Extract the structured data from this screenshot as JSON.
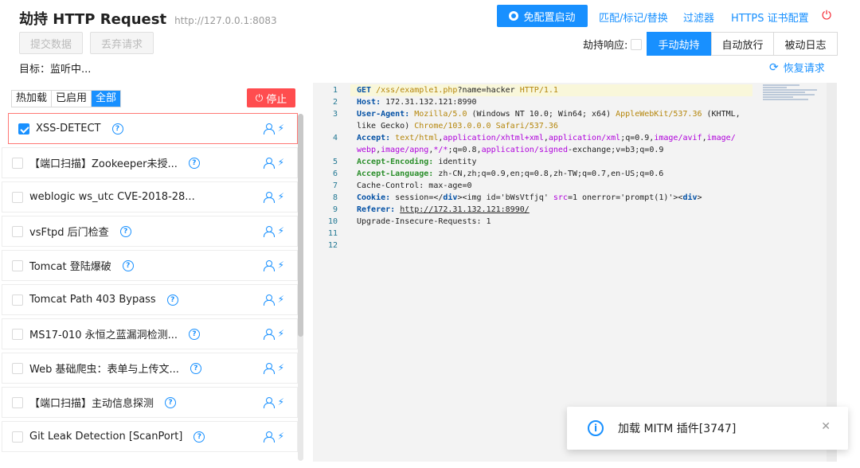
{
  "app": {
    "title": "劫持 HTTP Request",
    "url": "http://127.0.0.1:8083",
    "submit_label": "提交数据",
    "discard_label": "丢弃请求",
    "target_label": "目标：监听中..."
  },
  "toolbar": {
    "launch_label": "免配置启动",
    "match_label": "匹配/标记/替换",
    "filter_label": "过滤器",
    "https_label": "HTTPS 证书配置",
    "hijack_response_label": "劫持响应:",
    "modes": [
      "手动劫持",
      "自动放行",
      "被动日志"
    ],
    "active_mode": "手动劫持",
    "restore_label": "恢复请求"
  },
  "plugins": {
    "tabs": [
      "热加载",
      "已启用",
      "全部"
    ],
    "active_tab": "全部",
    "stop_label": "停止",
    "items": [
      {
        "name": "XSS-DETECT",
        "checked": true
      },
      {
        "name": "【端口扫描】Zookeeper未授...",
        "checked": false
      },
      {
        "name": "weblogic ws_utc CVE-2018-28...",
        "checked": false
      },
      {
        "name": "vsFtpd 后门检查",
        "checked": false
      },
      {
        "name": "Tomcat 登陆爆破",
        "checked": false
      },
      {
        "name": "Tomcat Path 403 Bypass",
        "checked": false
      },
      {
        "name": "MS17-010 永恒之蓝漏洞检测...",
        "checked": false
      },
      {
        "name": "Web 基础爬虫：表单与上传文...",
        "checked": false
      },
      {
        "name": "【端口扫描】主动信息探测",
        "checked": false
      },
      {
        "name": "Git Leak Detection [ScanPort]",
        "checked": false
      }
    ]
  },
  "editor": {
    "line_numbers": [
      "1",
      "2",
      "3",
      "",
      "4",
      "",
      "5",
      "6",
      "7",
      "8",
      "9",
      "10",
      "11",
      "12"
    ],
    "l1": {
      "method": "GET",
      "path": "/xss/example1.php",
      "query": "?name=hacker",
      "proto": "HTTP/1.1"
    },
    "l2": {
      "key": "Host:",
      "val": " 172.31.132.121:8990"
    },
    "l3": {
      "key": "User-Agent:",
      "a": " Mozilla/5.0",
      "b": " (Windows NT 10.0; Win64; x64) ",
      "c": "AppleWebKit/537.36",
      "d": " (KHTML,"
    },
    "l3b": {
      "a": "like Gecko) ",
      "b": "Chrome/103.0.0.0",
      "c": " ",
      "d": "Safari/537.36"
    },
    "l4": {
      "key": "Accept:",
      "a": " text/html",
      "b": ",",
      "c": "application/xhtml+xml",
      "d": ",",
      "e": "application/xml",
      "f": ";q=0.9,",
      "g": "image/avif",
      "h": ",",
      "i": "image/"
    },
    "l4b": {
      "a": "webp",
      "b": ",",
      "c": "image/apng",
      "d": ",",
      "e": "*/*",
      "f": ";q=0.8,",
      "g": "application/signed",
      "h": "-exchange;v=b3;q=0.9"
    },
    "l5": {
      "key": "Accept-Encoding:",
      "val": " identity"
    },
    "l6": {
      "key": "Accept-Language:",
      "val": " zh-CN,zh;q=0.9,en;q=0.8,zh-TW;q=0.7,en-US;q=0.6"
    },
    "l7": {
      "val": "Cache-Control: max-age=0"
    },
    "l8": {
      "key": "Cookie:",
      "a": " session=</",
      "b": "div",
      "c": "><img id='bWsVtfjq' ",
      "d": "src",
      "e": "=1 onerror='prompt(1)'><",
      "f": "div",
      "g": ">"
    },
    "l9": {
      "key": "Referer:",
      "val": "http://172.31.132.121:8990/"
    },
    "l10": {
      "val": "Upgrade-Insecure-Requests: 1"
    }
  },
  "toast": {
    "message": "加载 MITM 插件[3747]"
  },
  "colors": {
    "primary": "#1890ff",
    "danger": "#ff4d4f",
    "power": "#f5222d",
    "editor_bg": "#f3f3f3"
  }
}
